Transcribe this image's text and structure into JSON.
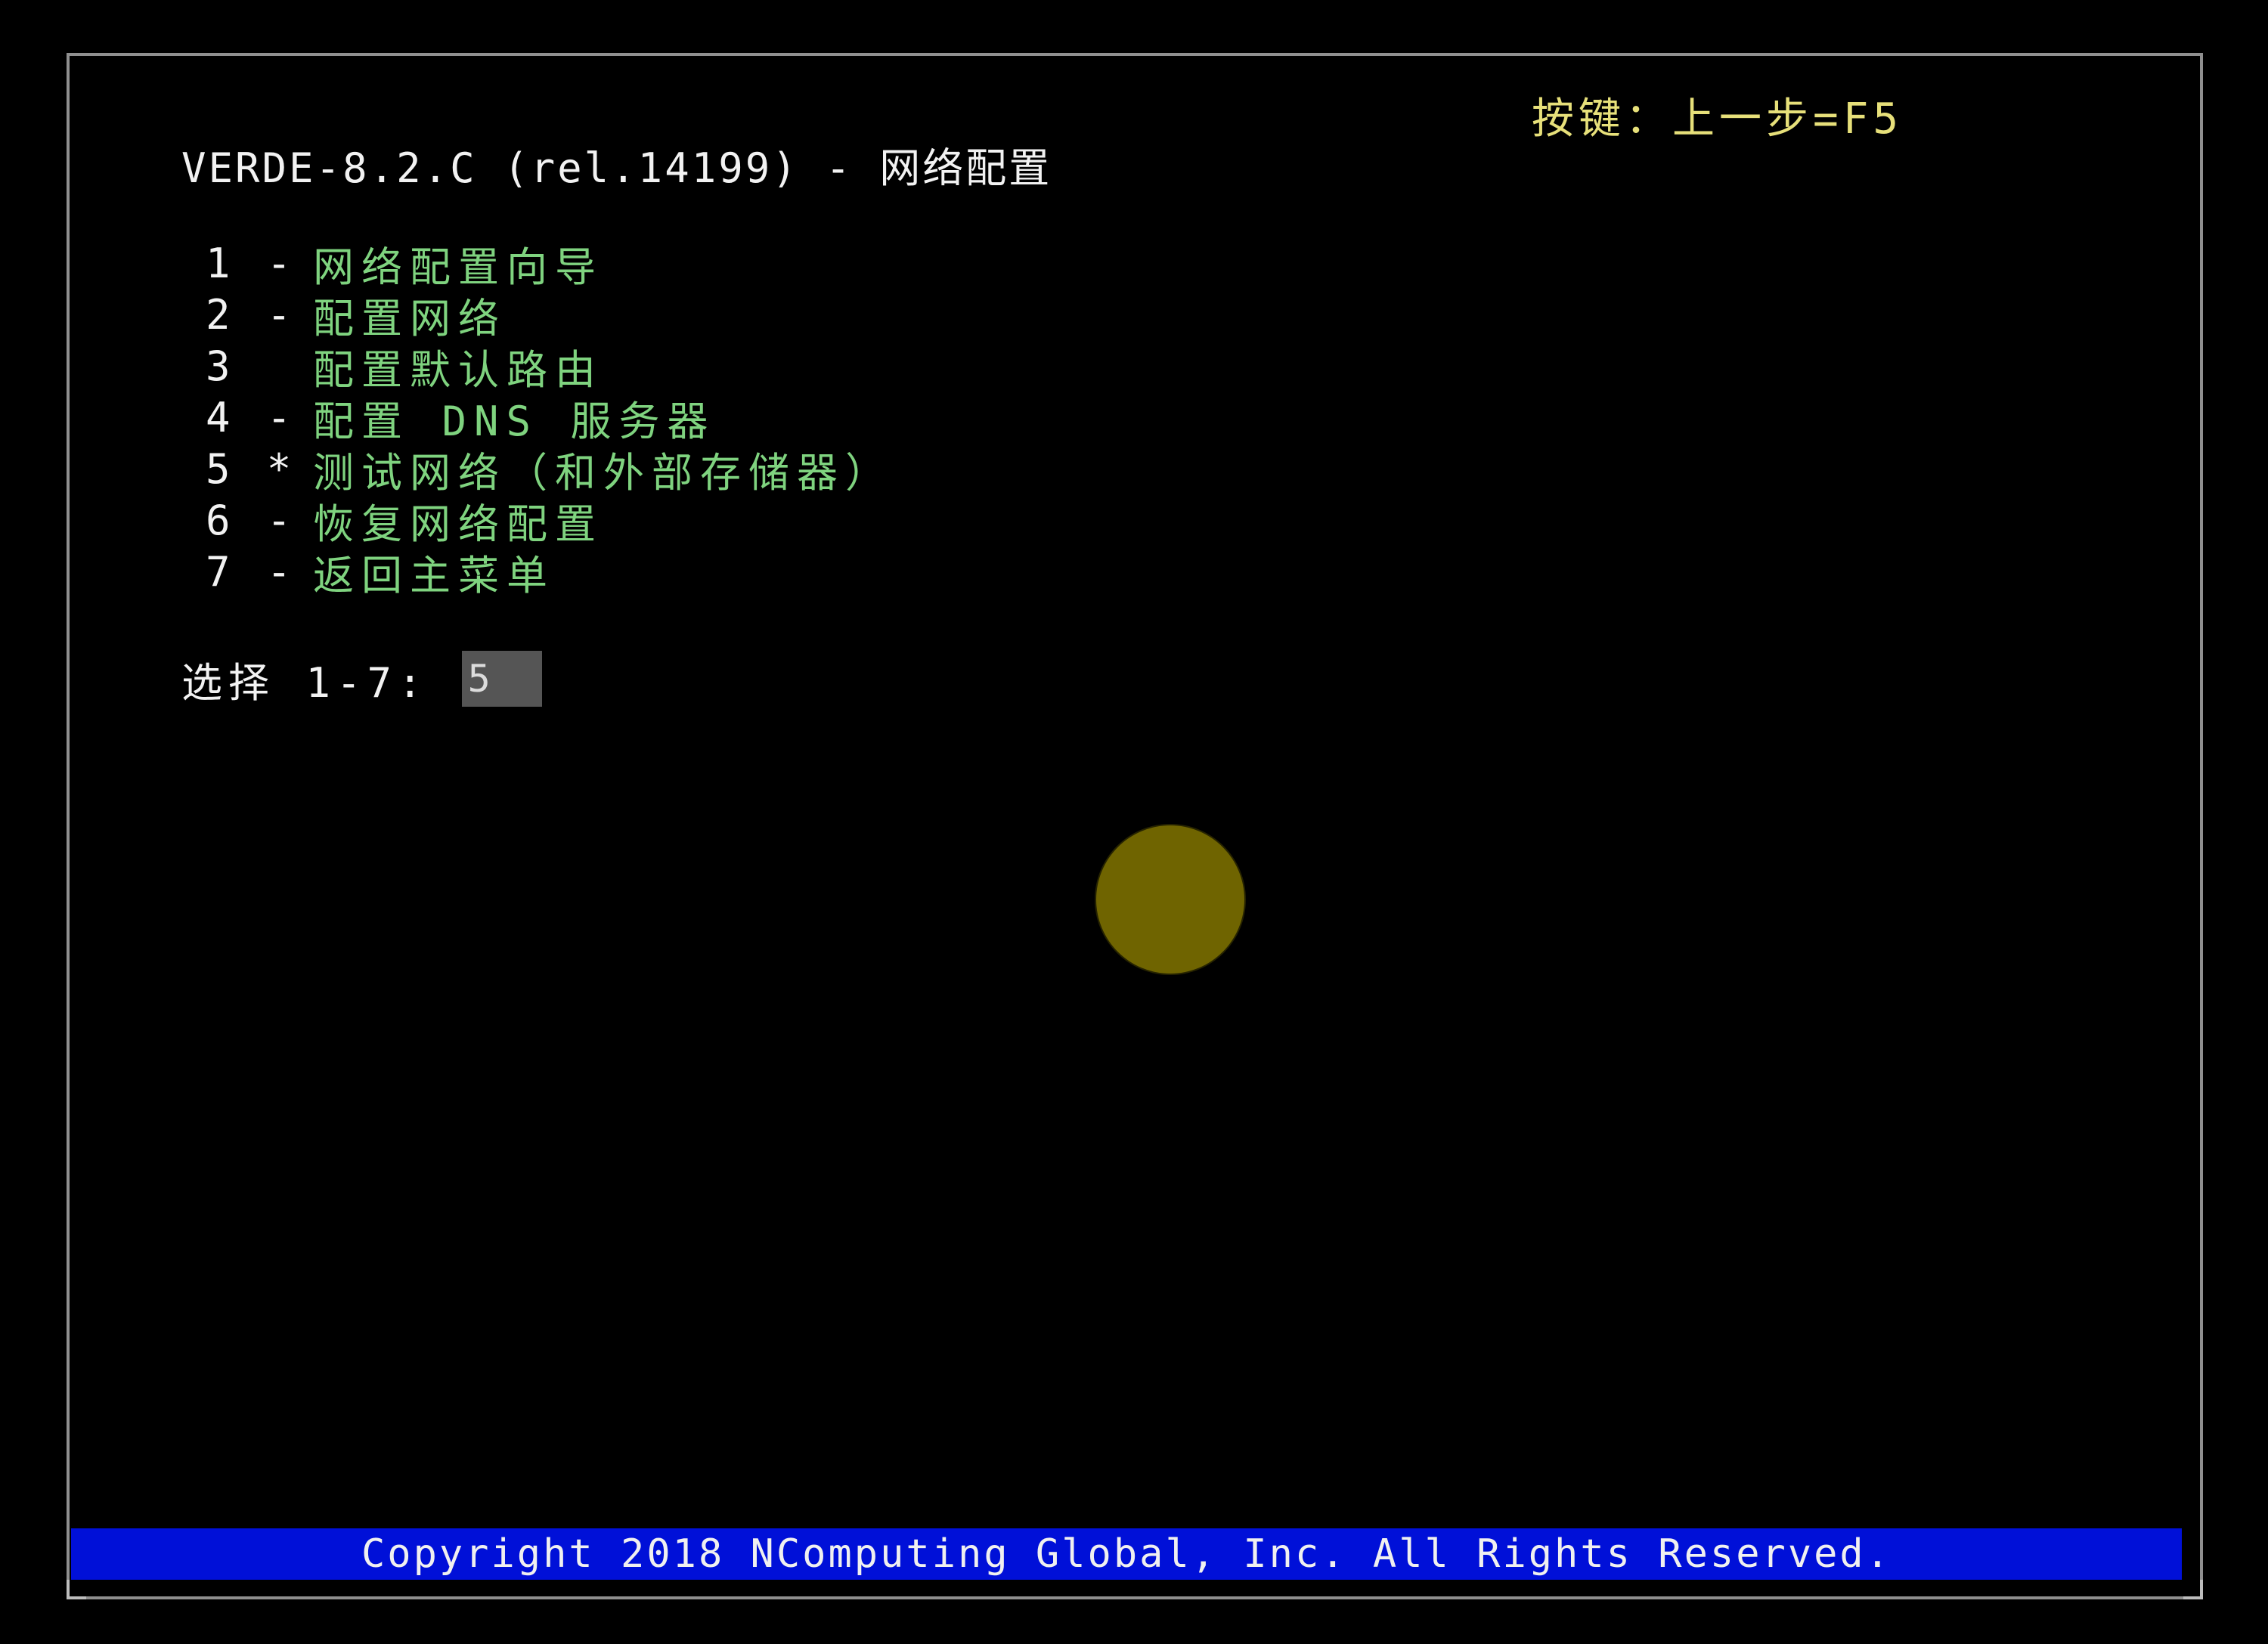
{
  "terminal": {
    "title": "VERDE-8.2.C (rel.14199) - 网络配置",
    "hint": "按键：上一步=F5"
  },
  "menu": {
    "items": [
      {
        "number": "1",
        "separator": "-",
        "label": "网络配置向导"
      },
      {
        "number": "2",
        "separator": "-",
        "label": "配置网络"
      },
      {
        "number": "3",
        "separator": "",
        "label": "配置默认路由"
      },
      {
        "number": "4",
        "separator": "-",
        "label": "配置 DNS 服务器"
      },
      {
        "number": "5",
        "separator": "*",
        "label": "测试网络（和外部存储器）"
      },
      {
        "number": "6",
        "separator": "-",
        "label": "恢复网络配置"
      },
      {
        "number": "7",
        "separator": "-",
        "label": "返回主菜单"
      }
    ]
  },
  "prompt": {
    "label": "选择 1-7:",
    "value": "5"
  },
  "footer": {
    "copyright": "Copyright 2018 NComputing Global, Inc.  All Rights Reserved."
  },
  "colors": {
    "background": "#000000",
    "title": "#f2f2f2",
    "hint": "#e7e07a",
    "menu_label": "#7fd37f",
    "footer_bar": "#0010d8",
    "input_background": "#555555",
    "cursor_dot": "#6f6400"
  },
  "icons": {
    "cursor": "cursor-dot-icon"
  }
}
